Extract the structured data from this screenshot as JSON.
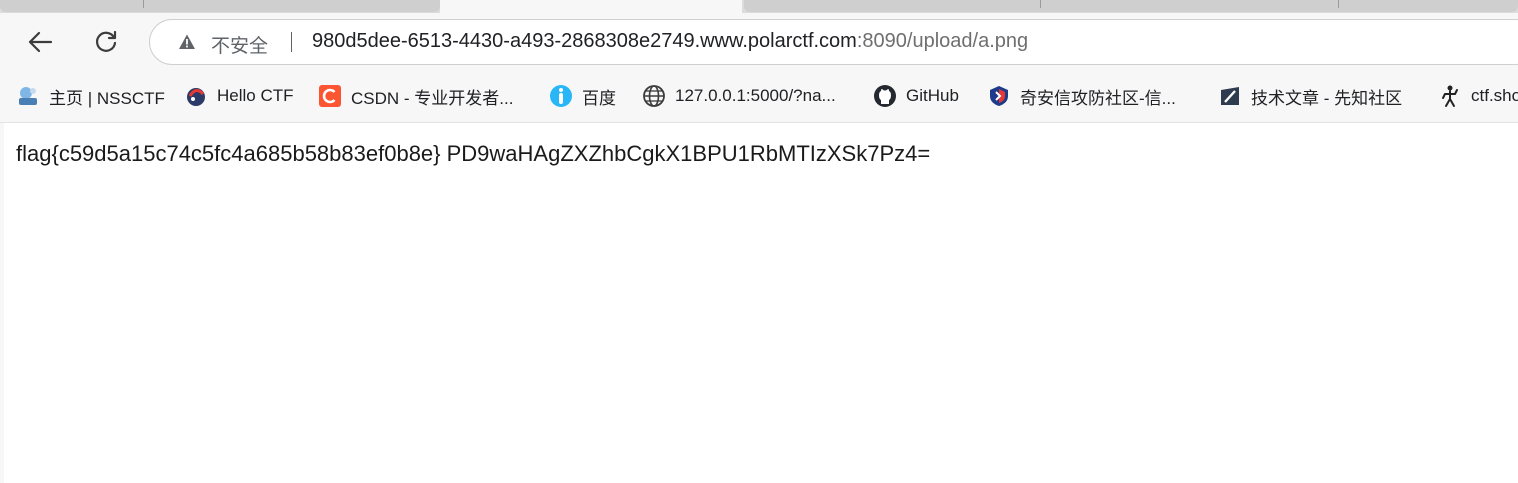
{
  "browser": {
    "address_bar": {
      "security_label": "不安全",
      "url_host": "980d5dee-6513-4430-a493-2868308e2749.www.polarctf.com",
      "url_path": ":8090/upload/a.png"
    },
    "bookmarks": [
      {
        "label": "主页 | NSSCTF",
        "icon": "nssctf-icon"
      },
      {
        "label": "Hello CTF",
        "icon": "hello-ctf-icon"
      },
      {
        "label": "CSDN - 专业开发者...",
        "icon": "csdn-icon"
      },
      {
        "label": "百度",
        "icon": "baidu-icon"
      },
      {
        "label": "127.0.0.1:5000/?na...",
        "icon": "globe-icon"
      },
      {
        "label": "GitHub",
        "icon": "github-icon"
      },
      {
        "label": "奇安信攻防社区-信...",
        "icon": "qianxin-icon"
      },
      {
        "label": "技术文章 - 先知社区",
        "icon": "xianzhi-icon"
      },
      {
        "label": "ctf.sho",
        "icon": "ctfshow-icon"
      }
    ],
    "colors": {
      "csdn": "#fc5531",
      "baidu": "#29b6f6",
      "qianxin_red": "#e53935",
      "qianxin_blue": "#1e3a8a"
    }
  },
  "page": {
    "content_text": "flag{c59d5a15c74c5fc4a685b58b83ef0b8e} PD9waHAgZXZhbCgkX1BPU1RbMTIzXSk7Pz4="
  }
}
